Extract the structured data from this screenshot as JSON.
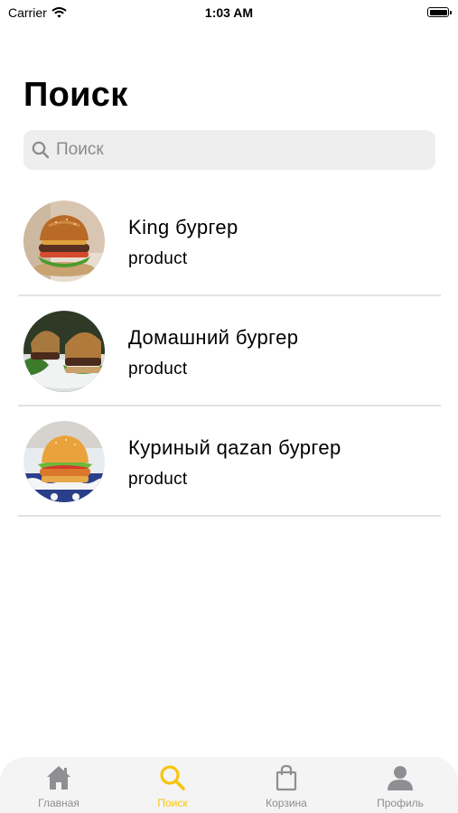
{
  "status_bar": {
    "carrier": "Carrier",
    "time": "1:03 AM"
  },
  "page_title": "Поиск",
  "search": {
    "placeholder": "Поиск",
    "value": ""
  },
  "products": [
    {
      "name": "King бургер",
      "subtitle": "product"
    },
    {
      "name": "Домашний бургер",
      "subtitle": "product"
    },
    {
      "name": "Куриный qazan бургер",
      "subtitle": "product"
    }
  ],
  "tab_bar": {
    "active_color": "#f8c40d",
    "tabs": [
      {
        "label": "Главная",
        "icon": "home-icon"
      },
      {
        "label": "Поиск",
        "icon": "search-icon",
        "active": true
      },
      {
        "label": "Корзина",
        "icon": "shopping-bag-icon"
      },
      {
        "label": "Профиль",
        "icon": "profile-icon"
      }
    ]
  }
}
